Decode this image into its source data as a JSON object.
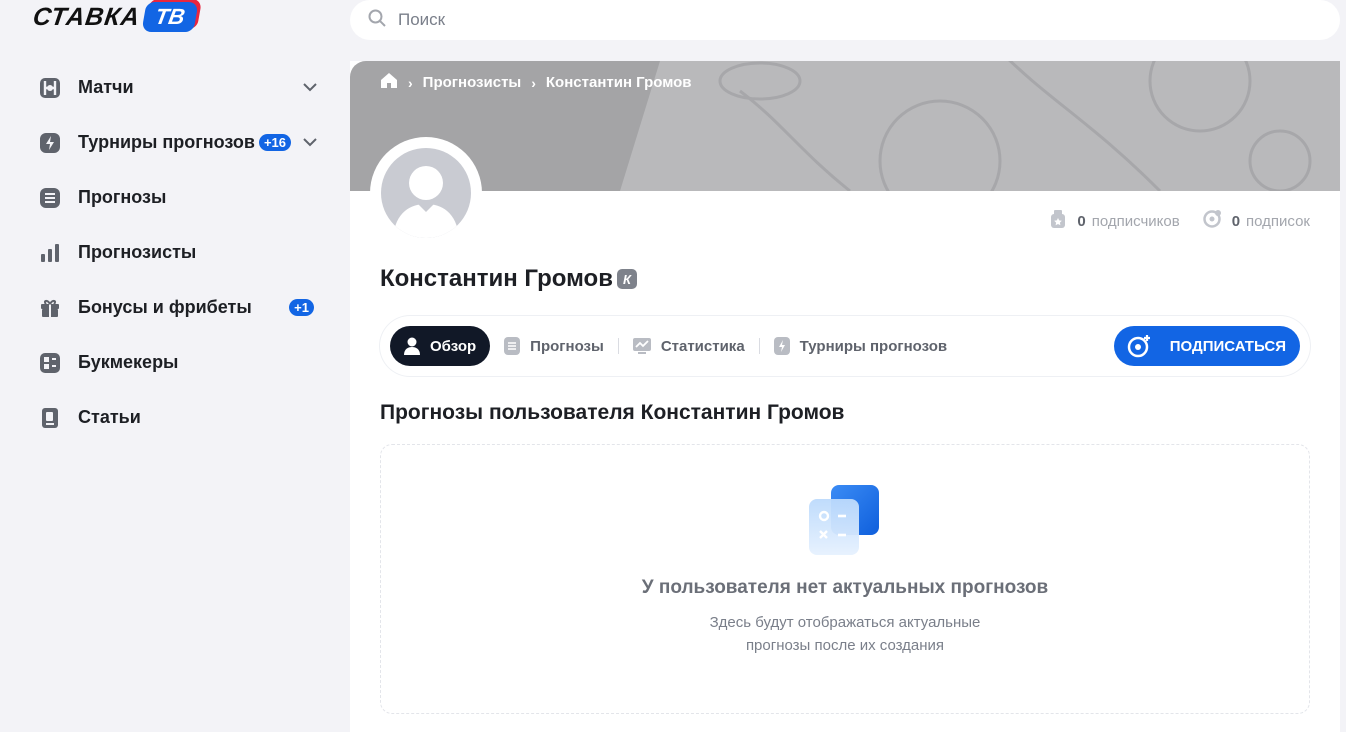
{
  "logo": {
    "text": "СТАВКА",
    "badge": "ТВ"
  },
  "search": {
    "placeholder": "Поиск"
  },
  "nav": {
    "items": [
      {
        "label": "Матчи",
        "icon": "matches-icon"
      },
      {
        "label": "Турниры прогнозов",
        "badge": "+16",
        "icon": "lightning-icon"
      },
      {
        "label": "Прогнозы",
        "icon": "list-icon"
      },
      {
        "label": "Прогнозисты",
        "icon": "bar-chart-icon"
      },
      {
        "label": "Бонусы и фрибеты",
        "badge": "+1",
        "icon": "gift-icon"
      },
      {
        "label": "Букмекеры",
        "icon": "bookmaker-icon"
      },
      {
        "label": "Статьи",
        "icon": "articles-icon"
      }
    ]
  },
  "breadcrumb": {
    "level1": "Прогнозисты",
    "level2": "Константин Громов"
  },
  "profile": {
    "name": "Константин Громов",
    "badge": "К",
    "subscribers_count": "0",
    "subscribers_label": "подписчиков",
    "subscriptions_count": "0",
    "subscriptions_label": "подписок"
  },
  "tabs": [
    {
      "label": "Обзор",
      "active": true
    },
    {
      "label": "Прогнозы"
    },
    {
      "label": "Статистика"
    },
    {
      "label": "Турниры прогнозов"
    }
  ],
  "subscribe_label": "ПОДПИСАТЬСЯ",
  "section_title": "Прогнозы пользователя Константин Громов",
  "empty": {
    "title": "У пользователя нет актуальных прогнозов",
    "desc_line1": "Здесь будут отображаться актуальные",
    "desc_line2": "прогнозы после их создания"
  },
  "colors": {
    "accent": "#1265e4",
    "logo_red": "#e8263f",
    "dark": "#111827",
    "muted": "#7a7f8a"
  }
}
